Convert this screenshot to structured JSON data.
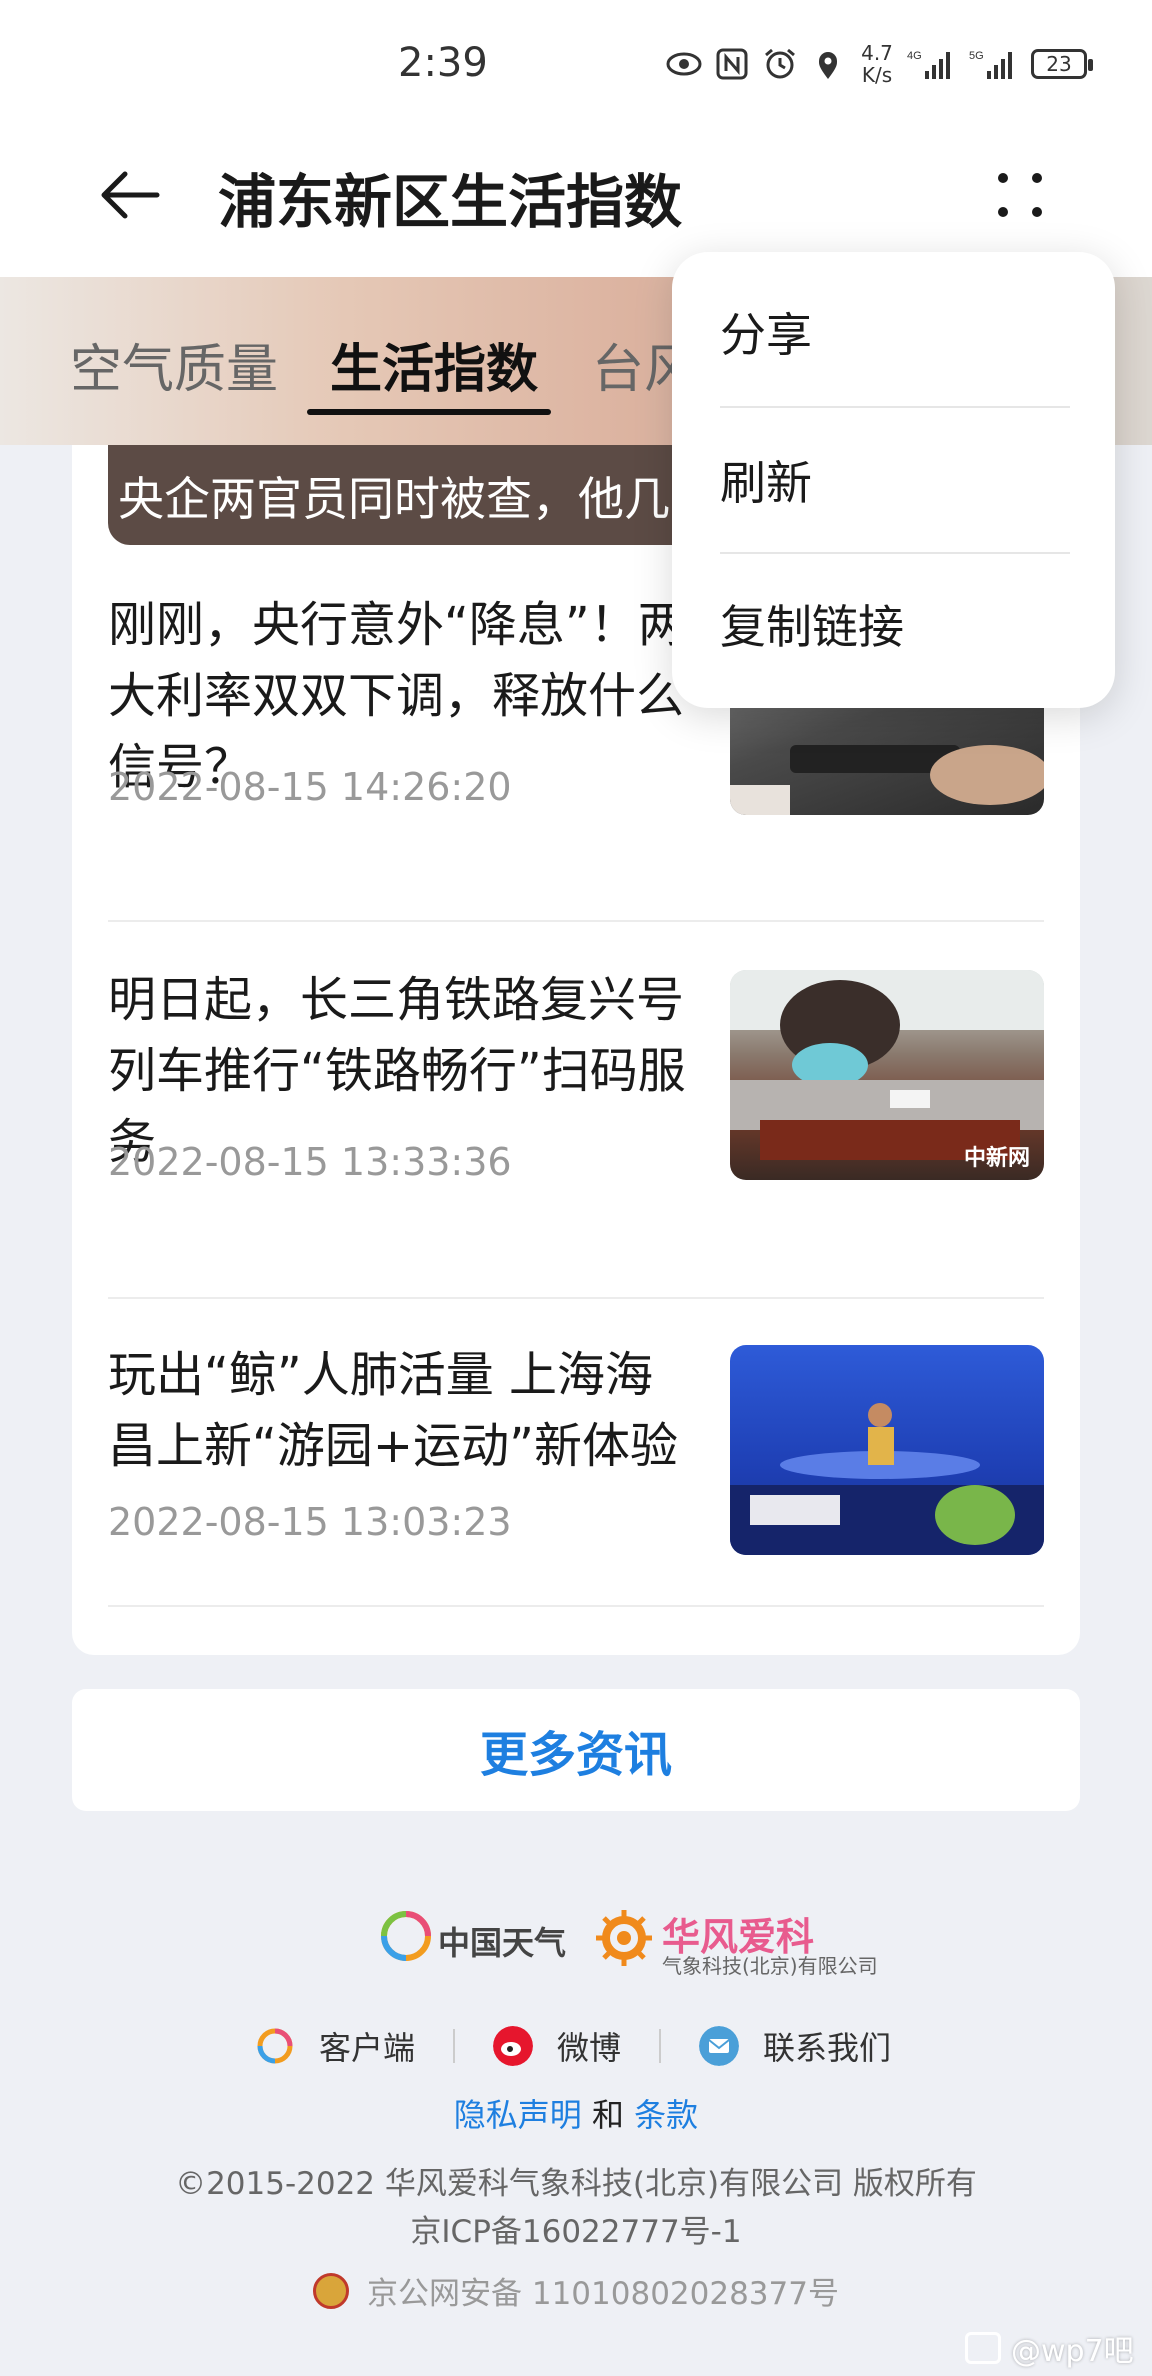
{
  "status_bar": {
    "time": "2:39",
    "net_speed_value": "4.7",
    "net_speed_unit": "K/s",
    "battery": "23"
  },
  "header": {
    "title": "浦东新区生活指数"
  },
  "tabs": [
    {
      "label": "空气质量"
    },
    {
      "label": "生活指数"
    },
    {
      "label": "台风"
    }
  ],
  "top_banner": {
    "text": "央企两官员同时被查，他几"
  },
  "news": [
    {
      "title": "刚刚，央行意外“降息”！两大利率双双下调，释放什么信号？",
      "date": "2022-08-15 14:26:20"
    },
    {
      "title": "明日起，长三角铁路复兴号列车推行“铁路畅行”扫码服务",
      "date": "2022-08-15 13:33:36",
      "thumb_caption": "中新网"
    },
    {
      "title": "玩出“鲸”人肺活量 上海海昌上新“游园+运动”新体验",
      "date": "2022-08-15 13:03:23"
    }
  ],
  "more_news_label": "更多资讯",
  "footer": {
    "logo1": "中国天气",
    "logo2": "华风爱科",
    "logo2_sub": "气象科技(北京)有限公司",
    "links": [
      "客户端",
      "微博",
      "联系我们"
    ],
    "privacy": "隐私声明",
    "and": "和",
    "terms": "条款",
    "copyright": "©2015-2022 华风爱科气象科技(北京)有限公司 版权所有",
    "icp": "京ICP备16022777号-1",
    "police": "京公网安备 11010802028377号"
  },
  "watermark": "@wp7吧",
  "popup_menu": {
    "items": [
      "分享",
      "刷新",
      "复制链接"
    ]
  }
}
